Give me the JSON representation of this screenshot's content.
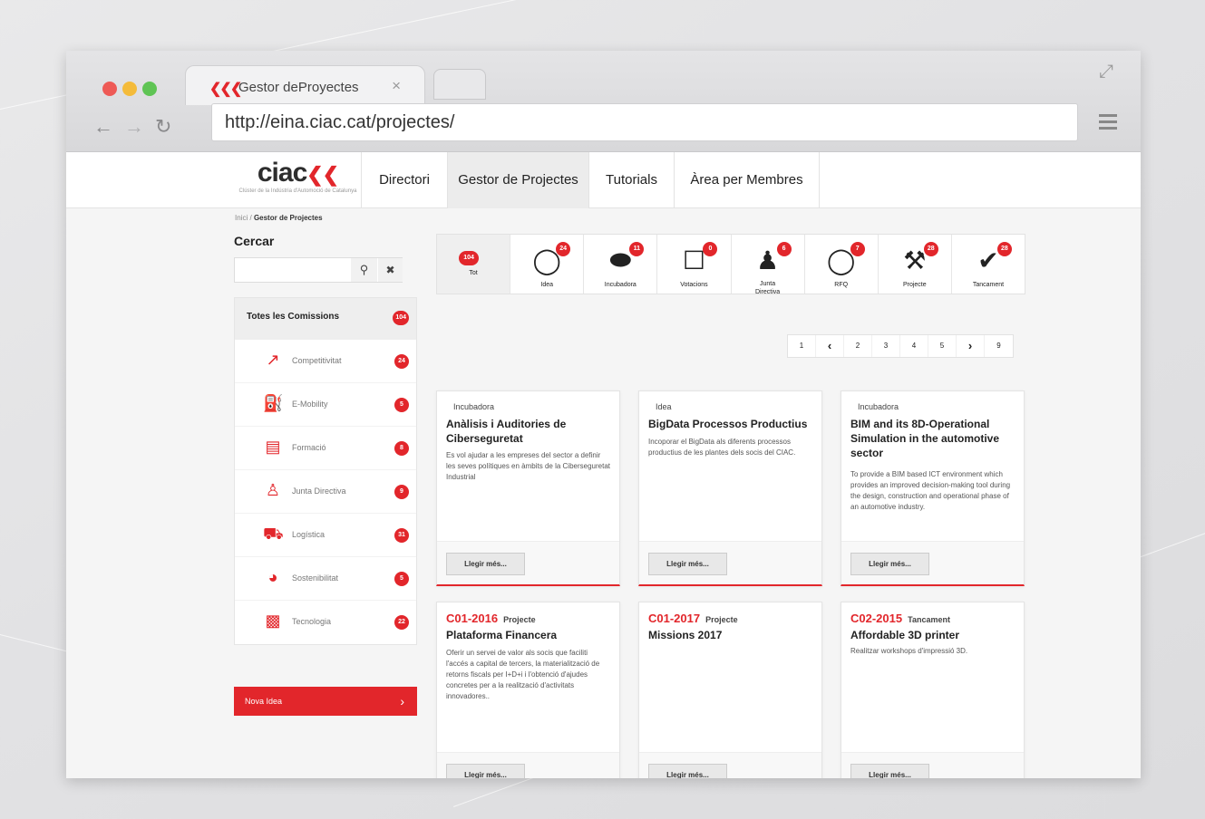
{
  "browser": {
    "tab_title": "Gestor deProyectes",
    "url": "http://eina.ciac.cat/projectes/"
  },
  "site": {
    "brand": "ciac",
    "brand_tagline": "Clúster de la Indústria d'Automoció de Catalunya",
    "nav": [
      "Directori",
      "Gestor de Projectes",
      "Tutorials",
      "Àrea per Membres"
    ],
    "breadcrumb": {
      "home": "Inici",
      "sep": "/",
      "current": "Gestor de Projectes"
    }
  },
  "sidebar": {
    "search_title": "Cercar",
    "search_placeholder": "",
    "all_label": "Totes les Comissions",
    "all_count": "104",
    "items": [
      {
        "label": "Competitivitat",
        "count": "24",
        "icon": "chart-icon"
      },
      {
        "label": "E-Mobility",
        "count": "5",
        "icon": "charging-station-icon"
      },
      {
        "label": "Formació",
        "count": "8",
        "icon": "presentation-icon"
      },
      {
        "label": "Junta Directiva",
        "count": "9",
        "icon": "group-icon"
      },
      {
        "label": "Logística",
        "count": "31",
        "icon": "forklift-icon"
      },
      {
        "label": "Sostenibilitat",
        "count": "5",
        "icon": "snail-icon"
      },
      {
        "label": "Tecnologia",
        "count": "22",
        "icon": "laptop-icon"
      }
    ],
    "cta": "Nova Idea"
  },
  "filters": [
    {
      "label": "Tot",
      "count": "104"
    },
    {
      "label": "Idea",
      "count": "24"
    },
    {
      "label": "Incubadora",
      "count": "11"
    },
    {
      "label": "Votacions",
      "count": "0"
    },
    {
      "label": "Junta Directiva",
      "count": "6"
    },
    {
      "label": "RFQ",
      "count": "7"
    },
    {
      "label": "Projecte",
      "count": "28"
    },
    {
      "label": "Tancament",
      "count": "28"
    }
  ],
  "pagination": [
    "1",
    "‹",
    "2",
    "3",
    "4",
    "5",
    "›",
    "9"
  ],
  "cards": [
    {
      "code": "",
      "category": "Incubadora",
      "title": "Anàlisis i Auditories de Ciberseguretat",
      "desc": "Es vol ajudar a les empreses del sector a definir les seves polítiques en àmbits de la Ciberseguretat Industrial",
      "btn": "Llegir més..."
    },
    {
      "code": "",
      "category": "Idea",
      "title": "BigData Processos Productius",
      "desc": "Incoporar el BigData als diferents processos productius de les plantes dels socis del CIAC.",
      "btn": "Llegir més..."
    },
    {
      "code": "",
      "category": "Incubadora",
      "title": "BIM and its 8D-Operational Simulation in the automotive sector",
      "desc": "To provide a BIM based ICT environment which provides an improved decision-making tool during the design, construction and operational phase of an automotive industry.",
      "btn": "Llegir més..."
    },
    {
      "code": "C01-2016",
      "category": "Projecte",
      "title": "Plataforma Financera",
      "desc": "Oferir un servei de valor als socis que faciliti l'accés a capital de tercers, la materialització de retorns fiscals per I+D+i i l'obtenció d'ajudes concretes per a la realització d'activitats innovadores..",
      "btn": "Llegir més..."
    },
    {
      "code": "C01-2017",
      "category": "Projecte",
      "title": "Missions 2017",
      "desc": "",
      "btn": "Llegir més..."
    },
    {
      "code": "C02-2015",
      "category": "Tancament",
      "title": "Affordable 3D printer",
      "desc": "Realitzar workshops d'impressió 3D.",
      "btn": "Llegir més..."
    }
  ]
}
